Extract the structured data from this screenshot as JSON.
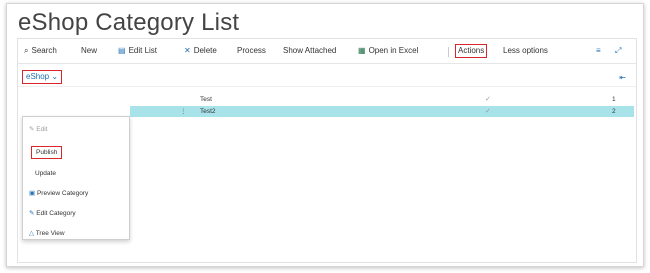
{
  "page": {
    "title": "eShop Category List"
  },
  "toolbar": {
    "search": "Search",
    "new": "New",
    "edit_list": "Edit List",
    "delete": "Delete",
    "process": "Process",
    "show_attached": "Show Attached",
    "open_in_excel": "Open in Excel",
    "actions": "Actions",
    "less_options": "Less options"
  },
  "filter": {
    "label": "eShop"
  },
  "menu": {
    "items": [
      {
        "label": "Edit",
        "disabled": true
      },
      {
        "label": "Publish"
      },
      {
        "label": "Update"
      },
      {
        "label": "Preview Category"
      },
      {
        "label": "Edit Category"
      },
      {
        "label": "Tree View"
      }
    ]
  },
  "table": {
    "rows": [
      {
        "name": "Test",
        "check": "✓",
        "number": "1",
        "selected": false
      },
      {
        "name": "Test2",
        "check": "✓",
        "number": "2",
        "selected": true
      }
    ]
  },
  "colors": {
    "accent": "#1f6fb5",
    "highlight": "#d9262c",
    "selected_row": "#a9e3ea"
  }
}
